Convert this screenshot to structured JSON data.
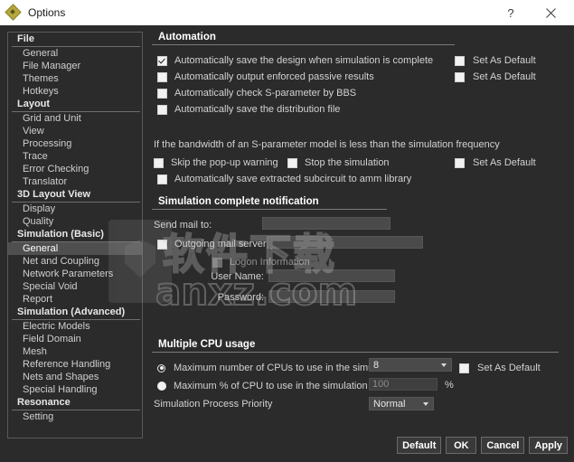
{
  "window": {
    "title": "Options",
    "icon": "diamond-app-icon",
    "help_label": "?",
    "close_label": "✕"
  },
  "sidebar": {
    "groups": [
      {
        "label": "File",
        "items": [
          {
            "label": "General",
            "selected": false
          },
          {
            "label": "File Manager",
            "selected": false
          },
          {
            "label": "Themes",
            "selected": false
          },
          {
            "label": "Hotkeys",
            "selected": false
          }
        ]
      },
      {
        "label": "Layout",
        "items": [
          {
            "label": "Grid and Unit",
            "selected": false
          },
          {
            "label": "View",
            "selected": false
          },
          {
            "label": "Processing",
            "selected": false
          },
          {
            "label": "Trace",
            "selected": false
          },
          {
            "label": "Error Checking",
            "selected": false
          },
          {
            "label": "Translator",
            "selected": false
          }
        ]
      },
      {
        "label": "3D Layout View",
        "items": [
          {
            "label": "Display",
            "selected": false
          },
          {
            "label": "Quality",
            "selected": false
          }
        ]
      },
      {
        "label": "Simulation (Basic)",
        "items": [
          {
            "label": "General",
            "selected": true
          },
          {
            "label": "Net and Coupling",
            "selected": false
          },
          {
            "label": "Network Parameters",
            "selected": false
          },
          {
            "label": "Special Void",
            "selected": false
          },
          {
            "label": "Report",
            "selected": false
          }
        ]
      },
      {
        "label": "Simulation (Advanced)",
        "items": [
          {
            "label": "Electric Models",
            "selected": false
          },
          {
            "label": "Field Domain",
            "selected": false
          },
          {
            "label": "Mesh",
            "selected": false
          },
          {
            "label": "Reference Handling",
            "selected": false
          },
          {
            "label": "Nets and Shapes",
            "selected": false
          },
          {
            "label": "Special Handling",
            "selected": false
          }
        ]
      },
      {
        "label": "Resonance",
        "items": [
          {
            "label": "Setting",
            "selected": false
          }
        ]
      }
    ]
  },
  "automation": {
    "title": "Automation",
    "options": [
      {
        "label": "Automatically save the design when simulation is complete",
        "checked": true
      },
      {
        "label": "Automatically output enforced passive results",
        "checked": false
      },
      {
        "label": "Automatically check S-parameter by BBS",
        "checked": false
      },
      {
        "label": "Automatically save the distribution file",
        "checked": false
      }
    ],
    "set_as_default_1": "Set As Default",
    "set_as_default_2": "Set As Default",
    "bandwidth_note": "If the bandwidth of an S-parameter model is less than the simulation frequency",
    "skip_popup_label": "Skip the pop-up warning",
    "stop_simulation_label": "Stop the simulation",
    "set_as_default_3": "Set As Default",
    "save_subcircuit_label": "Automatically save extracted subcircuit to amm library"
  },
  "notification": {
    "title": "Simulation complete notification",
    "send_mail_label": "Send mail to:",
    "send_mail_value": "",
    "smtp_label": "Outgoing mail server (SMTP):",
    "smtp_value": "",
    "logon_label": "Logon Information",
    "username_label": "User Name:",
    "username_value": "",
    "password_label": "Password:",
    "password_value": ""
  },
  "cpu": {
    "title": "Multiple CPU usage",
    "max_cpus_label": "Maximum number of CPUs to use in the simulation",
    "max_cpus_value": "8",
    "max_cpus_set_default": "Set As Default",
    "max_percent_label": "Maximum % of CPU to use in the simulation",
    "max_percent_value": "100",
    "percent_suffix": "%",
    "priority_label": "Simulation Process Priority",
    "priority_value": "Normal"
  },
  "buttons": {
    "default": "Default",
    "ok": "OK",
    "cancel": "Cancel",
    "apply": "Apply"
  },
  "watermark": {
    "chinese": "软件下载",
    "site": "anxz.com"
  },
  "colors": {
    "window_bg": "#2b2b2b",
    "titlebar_bg": "#ffffff",
    "selected_item": "#4f4f4f",
    "accent_icon": "#b5a642",
    "field_bg": "#4a4a4a"
  }
}
